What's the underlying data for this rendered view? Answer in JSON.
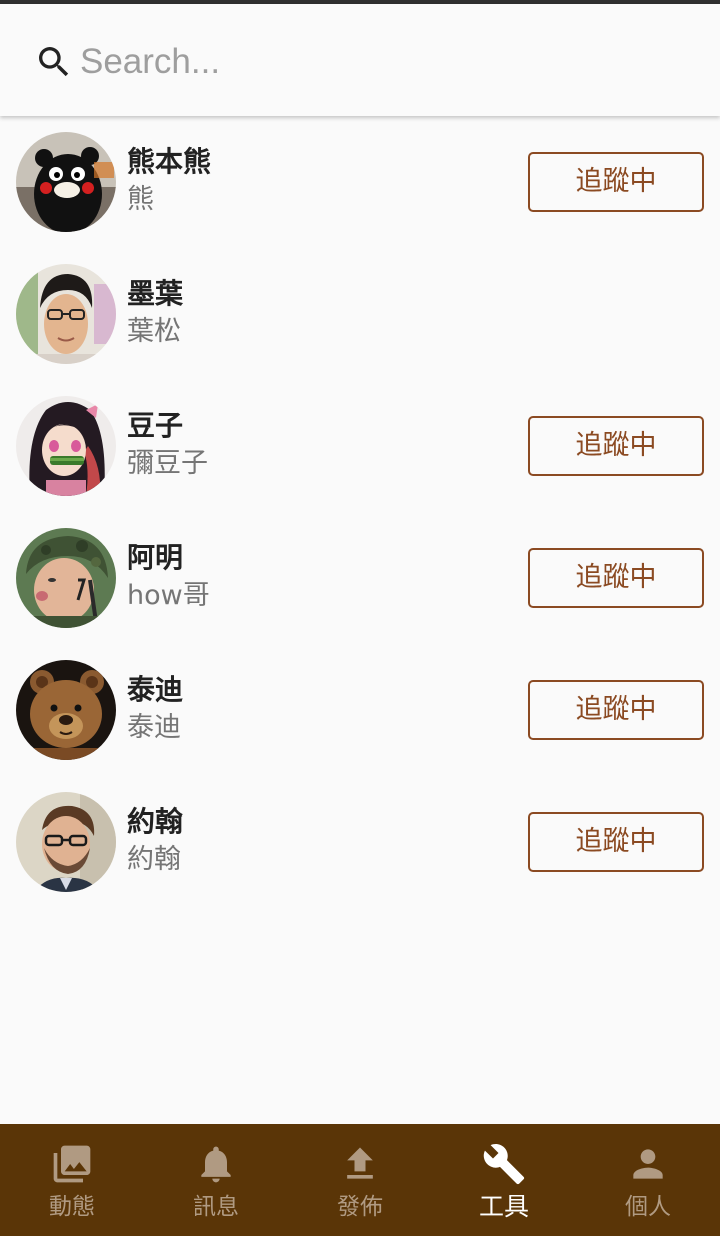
{
  "search": {
    "placeholder": "Search..."
  },
  "users": [
    {
      "name": "熊本熊",
      "handle": "熊",
      "following": true,
      "button_label": "追蹤中",
      "avatar": "kumamon-avatar"
    },
    {
      "name": "墨葉",
      "handle": "葉松",
      "following": false,
      "button_label": "",
      "avatar": "man-glasses-avatar"
    },
    {
      "name": "豆子",
      "handle": "彌豆子",
      "following": true,
      "button_label": "追蹤中",
      "avatar": "anime-girl-avatar"
    },
    {
      "name": "阿明",
      "handle": "how哥",
      "following": true,
      "button_label": "追蹤中",
      "avatar": "soldier-avatar"
    },
    {
      "name": "泰迪",
      "handle": "泰迪",
      "following": true,
      "button_label": "追蹤中",
      "avatar": "teddy-bear-avatar"
    },
    {
      "name": "約翰",
      "handle": "約翰",
      "following": true,
      "button_label": "追蹤中",
      "avatar": "bearded-man-avatar"
    }
  ],
  "nav": {
    "items": [
      {
        "label": "動態",
        "icon": "photo-library-icon",
        "active": false
      },
      {
        "label": "訊息",
        "icon": "bell-icon",
        "active": false
      },
      {
        "label": "發佈",
        "icon": "upload-icon",
        "active": false
      },
      {
        "label": "工具",
        "icon": "wrench-icon",
        "active": true
      },
      {
        "label": "個人",
        "icon": "person-icon",
        "active": false
      }
    ]
  },
  "colors": {
    "accent": "#8b4a22",
    "nav_background": "#5a3507",
    "nav_inactive": "#b09a82",
    "nav_active": "#ffffff"
  }
}
